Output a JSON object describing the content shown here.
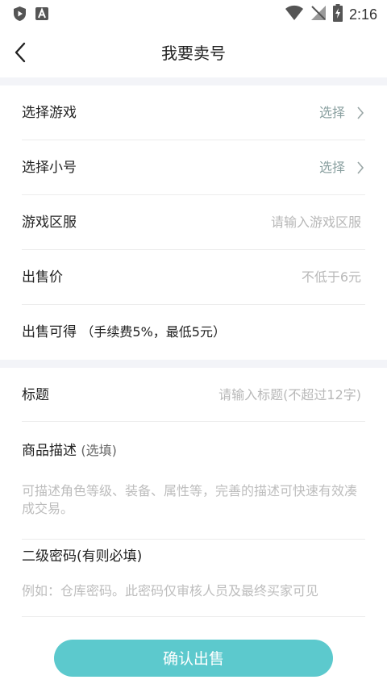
{
  "status_bar": {
    "time": "2:16"
  },
  "header": {
    "title": "我要卖号"
  },
  "form": {
    "select_game": {
      "label": "选择游戏",
      "value": "选择"
    },
    "select_account": {
      "label": "选择小号",
      "value": "选择"
    },
    "server": {
      "label": "游戏区服",
      "placeholder": "请输入游戏区服"
    },
    "price": {
      "label": "出售价",
      "placeholder": "不低于6元"
    },
    "earn": {
      "label": "出售可得",
      "note": "（手续费5%，最低5元）"
    },
    "subject": {
      "label": "标题",
      "placeholder": "请输入标题(不超过12字)"
    },
    "description": {
      "label": "商品描述",
      "optional": "(选填)",
      "placeholder": "可描述角色等级、装备、属性等，完善的描述可快速有效凑成交易。"
    },
    "password": {
      "label": "二级密码(有则必填)",
      "placeholder": "例如：仓库密码。此密码仅审核人员及最终买家可见"
    }
  },
  "submit": {
    "label": "确认出售"
  },
  "colors": {
    "accent": "#5cc9cd",
    "section_gap": "#f3f4f8",
    "value_text": "#8aa0a0",
    "placeholder": "#b8b8b8"
  }
}
